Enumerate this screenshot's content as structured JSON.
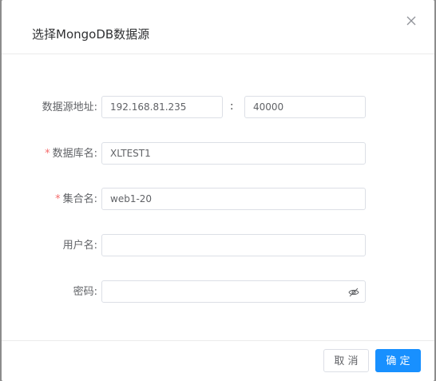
{
  "dialog": {
    "title": "选择MongoDB数据源",
    "close_icon": "close-icon"
  },
  "form": {
    "datasource_address": {
      "label": "数据源地址:",
      "host_value": "192.168.81.235",
      "separator": ":",
      "port_value": "40000"
    },
    "database_name": {
      "required_mark": "*",
      "label": "数据库名:",
      "value": "XLTEST1"
    },
    "collection_name": {
      "required_mark": "*",
      "label": "集合名:",
      "value": "web1-20"
    },
    "username": {
      "label": "用户名:",
      "value": ""
    },
    "password": {
      "label": "密码:",
      "value": "",
      "toggle_icon": "eye-slash-icon"
    }
  },
  "footer": {
    "cancel_label": "取 消",
    "confirm_label": "确 定"
  },
  "colors": {
    "primary": "#1890ff",
    "required": "#f56c6c",
    "overlay": "#8c8c8c"
  }
}
